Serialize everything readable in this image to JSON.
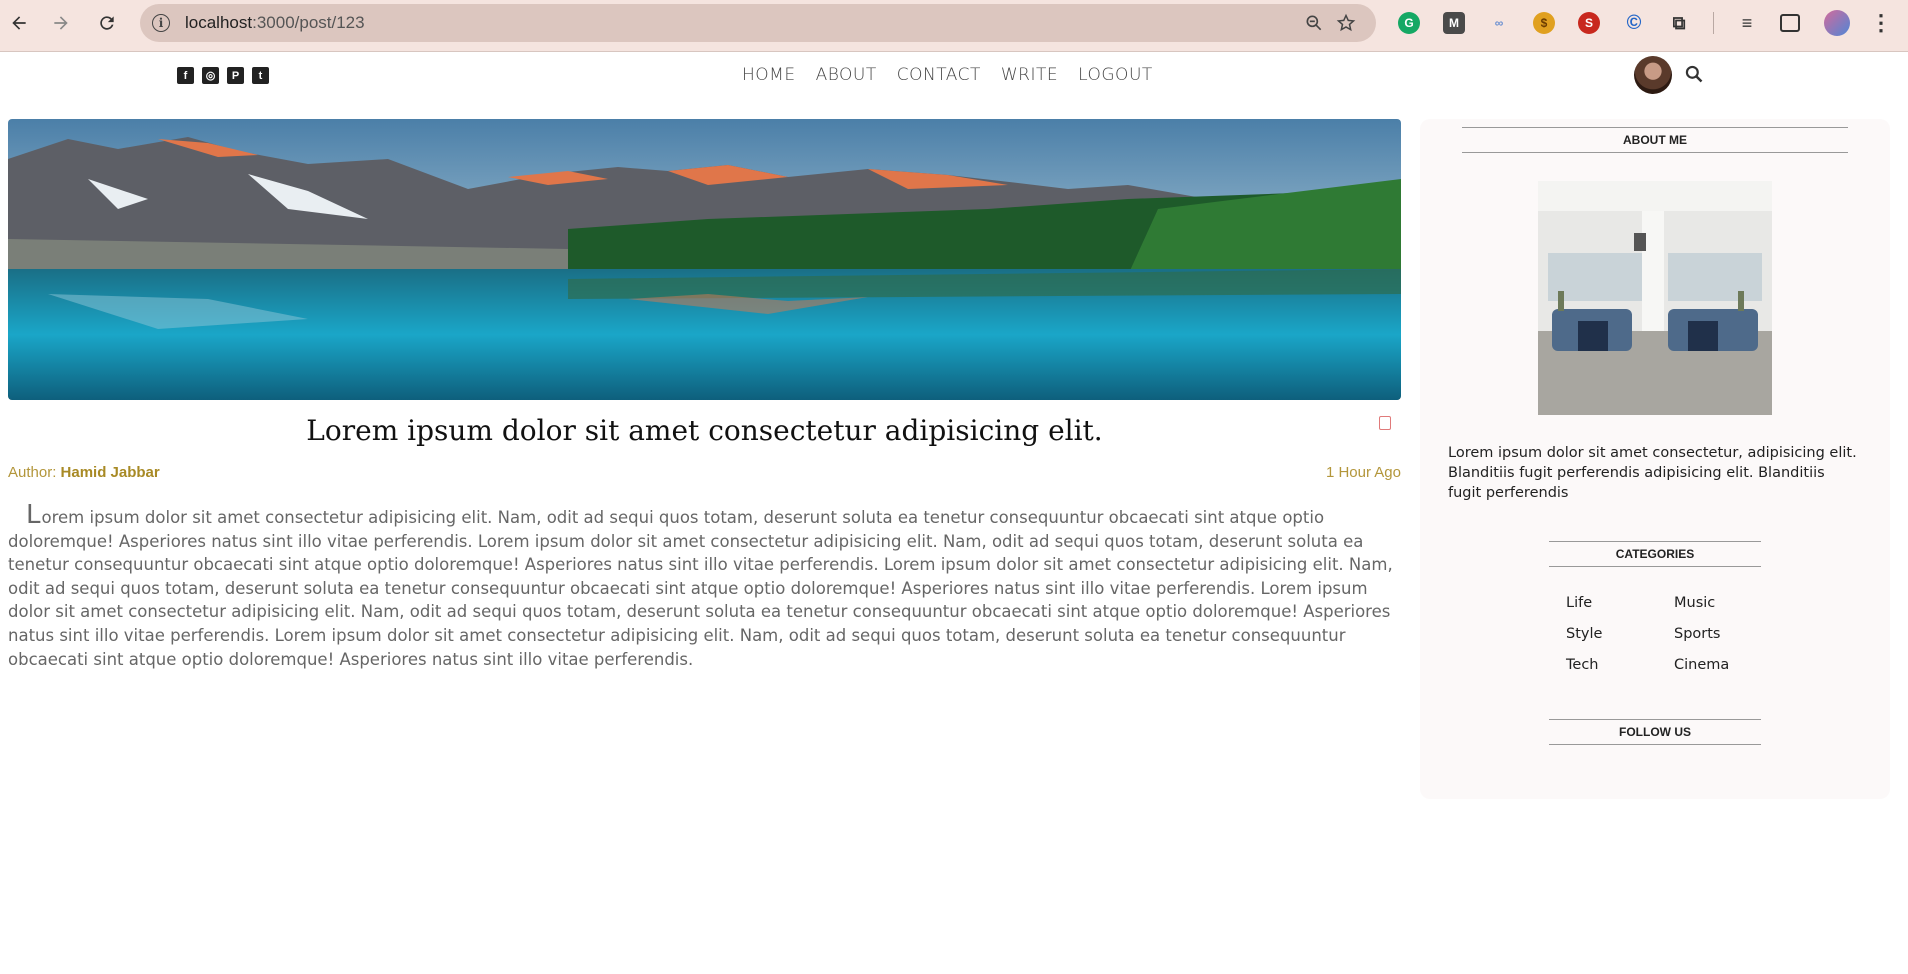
{
  "browser": {
    "url_host": "localhost",
    "url_path": ":3000/post/123",
    "extensions": [
      "grammarly-icon",
      "m-icon",
      "link-icon",
      "seo-badge-icon",
      "seo-icon",
      "copyright-icon",
      "puzzle-icon"
    ]
  },
  "header": {
    "social": [
      "facebook-icon",
      "instagram-icon",
      "pinterest-icon",
      "twitter-icon"
    ],
    "menu": [
      "HOME",
      "ABOUT",
      "CONTACT",
      "WRITE",
      "LOGOUT"
    ]
  },
  "post": {
    "title": "Lorem ipsum dolor sit amet consectetur adipisicing elit.",
    "author_label": "Author: ",
    "author_name": "Hamid Jabbar",
    "time": "1 Hour Ago",
    "dropcap": "L",
    "body": "orem ipsum dolor sit amet consectetur adipisicing elit. Nam, odit ad sequi quos totam, deserunt soluta ea tenetur consequuntur obcaecati sint atque optio doloremque! Asperiores natus sint illo vitae perferendis. Lorem ipsum dolor sit amet consectetur adipisicing elit. Nam, odit ad sequi quos totam, deserunt soluta ea tenetur consequuntur obcaecati sint atque optio doloremque! Asperiores natus sint illo vitae perferendis. Lorem ipsum dolor sit amet consectetur adipisicing elit. Nam, odit ad sequi quos totam, deserunt soluta ea tenetur consequuntur obcaecati sint atque optio doloremque! Asperiores natus sint illo vitae perferendis. Lorem ipsum dolor sit amet consectetur adipisicing elit. Nam, odit ad sequi quos totam, deserunt soluta ea tenetur consequuntur obcaecati sint atque optio doloremque! Asperiores natus sint illo vitae perferendis. Lorem ipsum dolor sit amet consectetur adipisicing elit. Nam, odit ad sequi quos totam, deserunt soluta ea tenetur consequuntur obcaecati sint atque optio doloremque! Asperiores natus sint illo vitae perferendis."
  },
  "sidebar": {
    "about_title": "ABOUT ME",
    "about_text": "Lorem ipsum dolor sit amet consectetur, adipisicing elit. Blanditiis fugit perferendis adipisicing elit. Blanditiis fugit perferendis",
    "categories_title": "CATEGORIES",
    "categories": [
      "Life",
      "Music",
      "Style",
      "Sports",
      "Tech",
      "Cinema"
    ],
    "follow_title": "FOLLOW US"
  },
  "colors": {
    "chrome_bg": "#f5e4df",
    "accent_gold": "#b3963b"
  }
}
